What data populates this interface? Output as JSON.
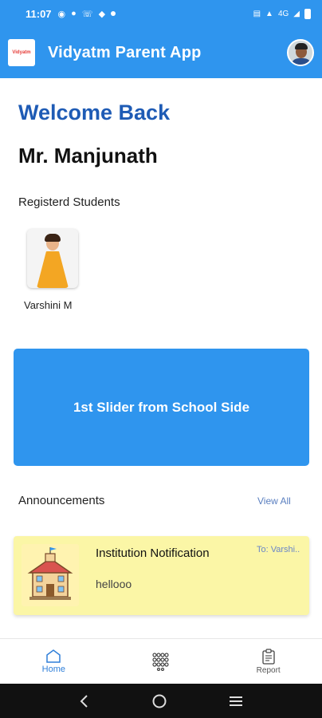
{
  "status_bar": {
    "time": "11:07",
    "network": "4G"
  },
  "app_bar": {
    "logo_text": "Vidyatm",
    "title": "Vidyatm Parent App"
  },
  "home": {
    "welcome": "Welcome Back",
    "parent_name": "Mr. Manjunath",
    "students_label": "Registerd Students",
    "students": [
      {
        "name": "Varshini M"
      }
    ],
    "slider_text": "1st Slider from School Side",
    "announcements_label": "Announcements",
    "view_all": "View All",
    "announcements": [
      {
        "title": "Institution Notification",
        "to": "To: Varshi..",
        "body": "hellooo"
      }
    ]
  },
  "bottom_nav": {
    "items": [
      {
        "label": "Home",
        "icon": "home-icon",
        "active": true
      },
      {
        "label": "",
        "icon": "grid-icon",
        "active": false
      },
      {
        "label": "Report",
        "icon": "report-icon",
        "active": false
      }
    ]
  },
  "colors": {
    "primary": "#2f95ee",
    "heading_blue": "#1e5bb5",
    "card_yellow": "#fbf6a6",
    "active_nav": "#2f7fd9"
  }
}
